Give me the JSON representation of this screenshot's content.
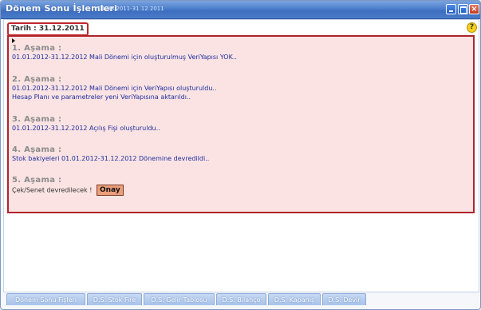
{
  "window": {
    "title": "Dönem Sonu İşlemleri",
    "subtitle": "01.08.2011-31.12.2011",
    "help": "?"
  },
  "date_label": "Tarih : 31.12.2011",
  "steps": [
    {
      "heading": "1. Aşama :",
      "lines": [
        "01.01.2012-31.12.2012 Mali Dönemi için oluşturulmuş VeriYapısı YOK.."
      ]
    },
    {
      "heading": "2. Aşama :",
      "lines": [
        "01.01.2012-31.12.2012 Mali Dönemi için VeriYapısı oluşturuldu..",
        "Hesap Planı ve parametreler yeni VeriYapısına aktarıldı.."
      ]
    },
    {
      "heading": "3. Aşama :",
      "lines": [
        "01.01.2012-31.12.2012 Açılış Fişi oluşturuldu.."
      ]
    },
    {
      "heading": "4. Aşama :",
      "lines": [
        "Stok bakiyeleri 01.01.2012-31.12.2012 Dönemine devredildi.."
      ]
    },
    {
      "heading": "5. Aşama :",
      "lines": [
        "Çek/Senet devredilecek !"
      ],
      "button": "Onay"
    }
  ],
  "tabs": [
    "Dönem Sonu Fişleri",
    "D.S. Stok Fire",
    "D.S. Gelir Tablosu",
    "D.S. Bilanço",
    "D.S. Kapanış",
    "D.S. Devir"
  ]
}
